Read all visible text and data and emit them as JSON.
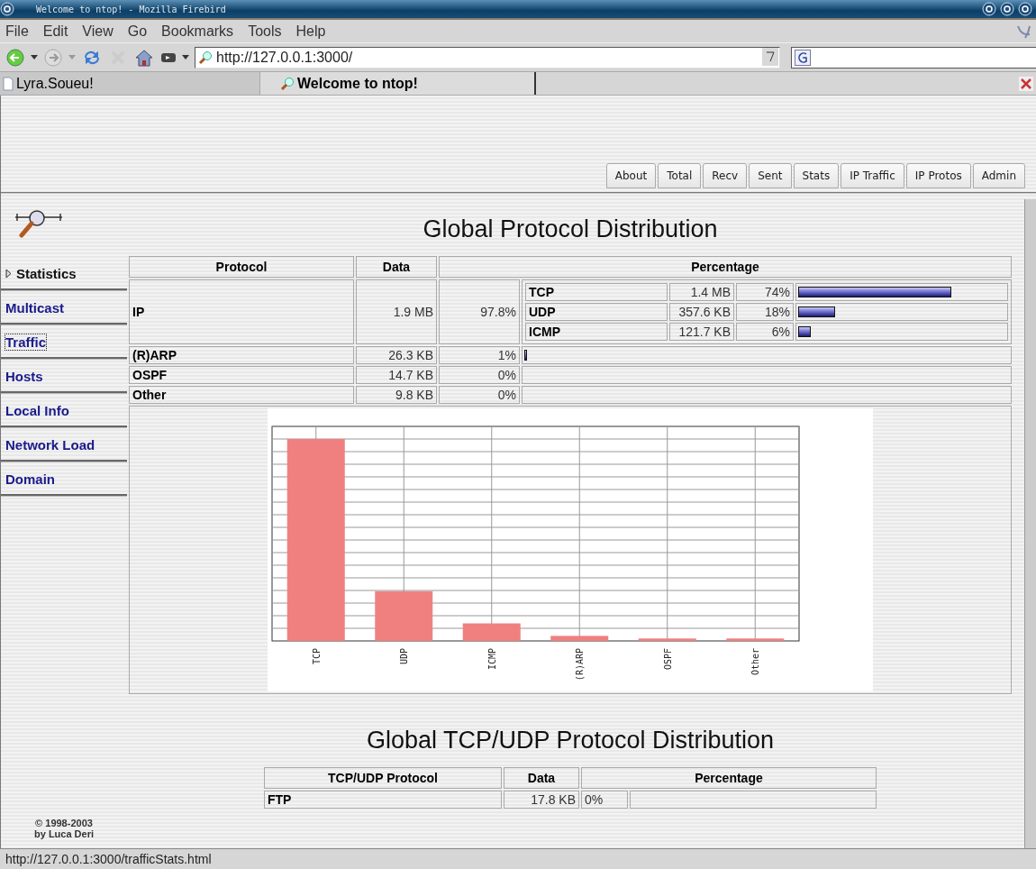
{
  "window": {
    "title": "Welcome to ntop! - Mozilla Firebird"
  },
  "menu": [
    "File",
    "Edit",
    "View",
    "Go",
    "Bookmarks",
    "Tools",
    "Help"
  ],
  "address": {
    "url": "http://127.0.0.1:3000/"
  },
  "browser_tabs": [
    {
      "label": "Lyra.Soueu!",
      "selected": false
    },
    {
      "label": "Welcome to ntop!",
      "selected": true
    }
  ],
  "ntop_tabs": [
    "About",
    "Total",
    "Recv",
    "Sent",
    "Stats",
    "IP Traffic",
    "IP Protos",
    "Admin"
  ],
  "sidebar": {
    "items": [
      {
        "label": "Statistics",
        "kind": "heading",
        "focused": false
      },
      {
        "label": "Multicast",
        "kind": "link",
        "focused": false
      },
      {
        "label": "Traffic",
        "kind": "link",
        "focused": true
      },
      {
        "label": "Hosts",
        "kind": "link",
        "focused": false
      },
      {
        "label": "Local Info",
        "kind": "link",
        "focused": false
      },
      {
        "label": "Network Load",
        "kind": "link",
        "focused": false
      },
      {
        "label": "Domain",
        "kind": "link",
        "focused": false
      }
    ],
    "copyright": [
      "© 1998-2003",
      "by Luca Deri"
    ]
  },
  "protocol_section": {
    "title": "Global Protocol Distribution",
    "columns": [
      "Protocol",
      "Data",
      "Percentage"
    ],
    "rows": [
      {
        "name": "IP",
        "data": "1.9 MB",
        "percent": "97.8%",
        "children": [
          {
            "name": "TCP",
            "data": "1.4 MB",
            "percent": "74%",
            "level": 0.74
          },
          {
            "name": "UDP",
            "data": "357.6 KB",
            "percent": "18%",
            "level": 0.18
          },
          {
            "name": "ICMP",
            "data": "121.7 KB",
            "percent": "6%",
            "level": 0.06
          }
        ]
      },
      {
        "name": "(R)ARP",
        "data": "26.3 KB",
        "percent": "1%",
        "level": 0.005
      },
      {
        "name": "OSPF",
        "data": "14.7 KB",
        "percent": "0%"
      },
      {
        "name": "Other",
        "data": "9.8 KB",
        "percent": "0%"
      }
    ],
    "chart_labels": [
      "TCP",
      "UDP",
      "ICMP",
      "(R)ARP",
      "OSPF",
      "Other"
    ]
  },
  "tcp_udp_section": {
    "title": "Global TCP/UDP Protocol Distribution",
    "columns": [
      "TCP/UDP Protocol",
      "Data",
      "Percentage"
    ],
    "rows": [
      {
        "name": "FTP",
        "data": "17.8 KB",
        "percent": "0%"
      }
    ]
  },
  "status_bar": {
    "text": "http://127.0.0.1:3000/trafficStats.html"
  }
}
